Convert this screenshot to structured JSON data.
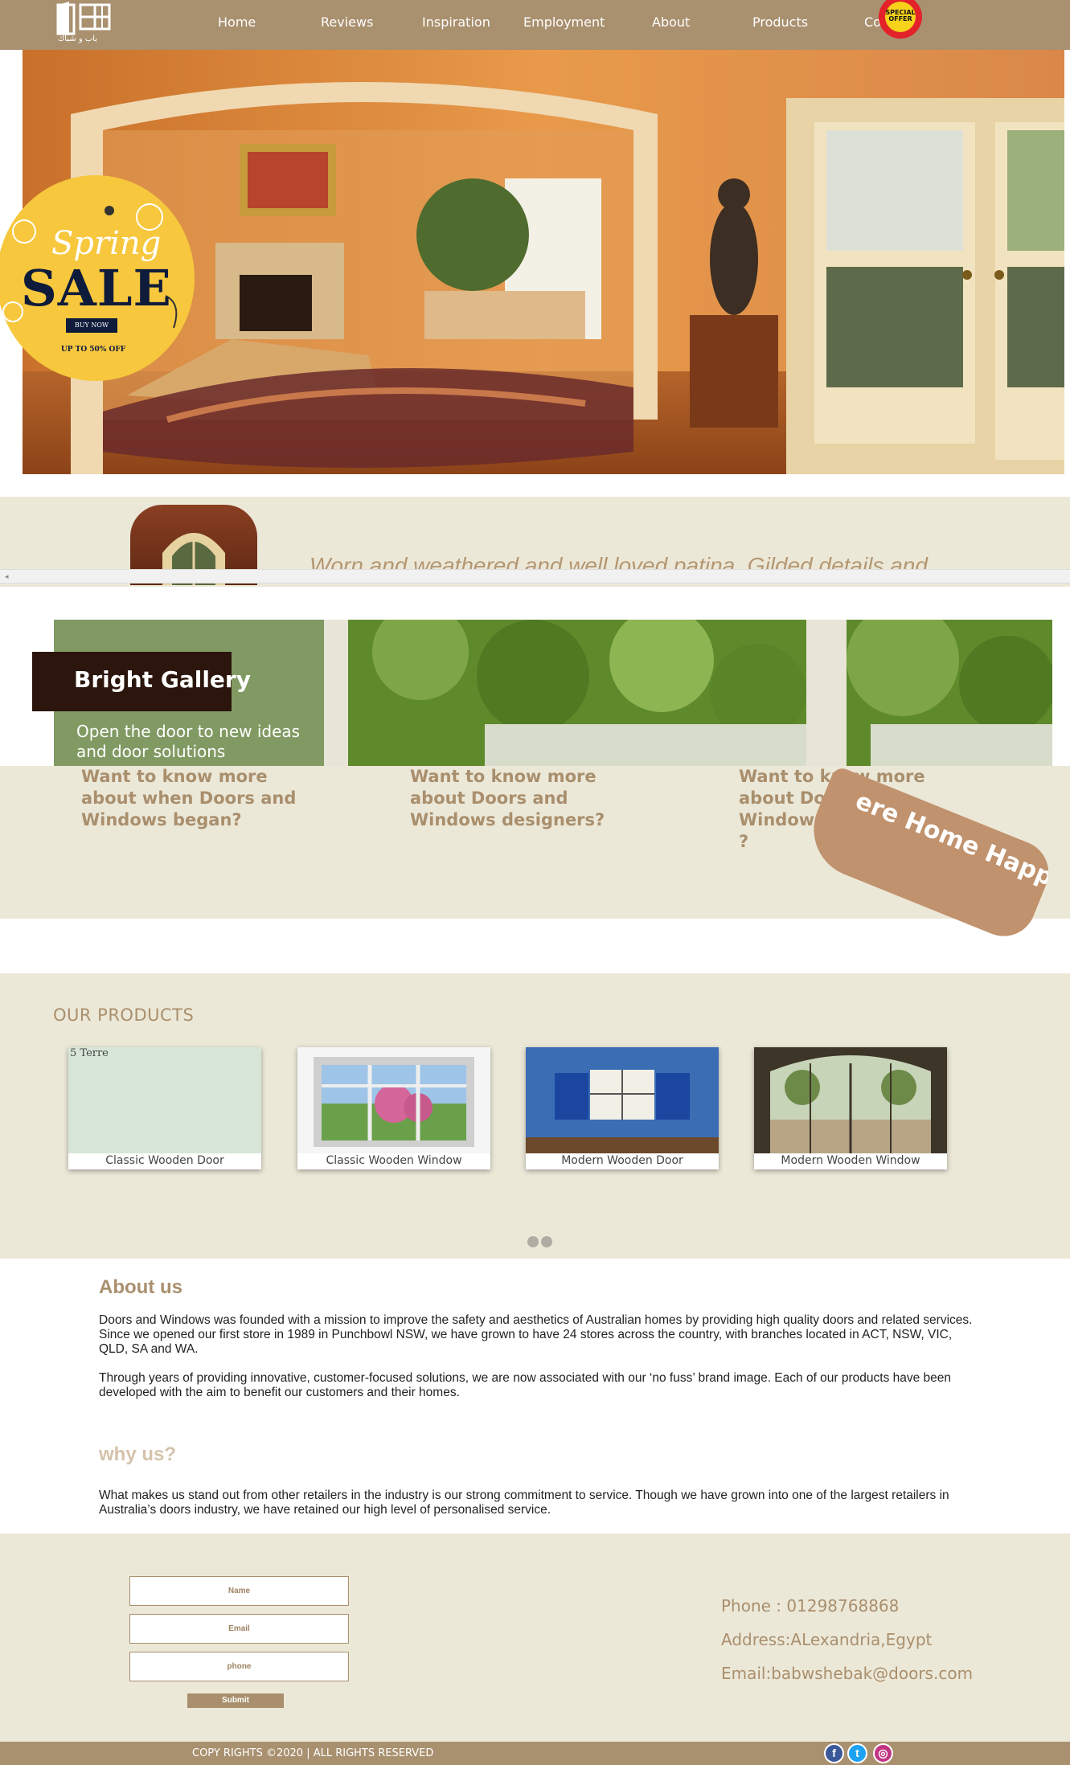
{
  "nav": {
    "logo_caption": "باب و شباك",
    "items": [
      "Home",
      "Reviews",
      "Inspiration",
      "Employment",
      "About",
      "Products",
      "Co"
    ],
    "offer_badge": "SPECIAL OFFER"
  },
  "sale_badge": {
    "spring": "Spring",
    "sale": "SALE",
    "button": "BUY NOW",
    "discount": "UP TO 50% OFF"
  },
  "strip": {
    "quote": "Worn and weathered and well loved patina. Gilded details and"
  },
  "gallery": {
    "title": "Bright Gallery",
    "subtitle": "Open the door to new ideas and door solutions",
    "questions": [
      "Want to know more about when Doors and Windows began?",
      "Want to know more about Doors and Windows designers?",
      "Want to know more about Doors and Windows contributors ?"
    ],
    "ribbon": "ere Home Happens"
  },
  "products": {
    "heading": "OUR PRODUCTS",
    "broken_image_alt": "5 Terre",
    "items": [
      {
        "caption": "Classic Wooden Door"
      },
      {
        "caption": "Classic Wooden Window"
      },
      {
        "caption": "Modern Wooden Door"
      },
      {
        "caption": "Modern Wooden Window"
      }
    ],
    "pager_dots": 2
  },
  "about": {
    "heading": "About us",
    "p1": "Doors and Windows was founded with a mission to improve the safety and aesthetics of Australian homes by providing high quality doors and related services. Since we opened our first store in 1989 in Punchbowl NSW, we have grown to have 24 stores across the country, with branches located in ACT, NSW, VIC, QLD, SA and WA.",
    "p2": "Through years of providing innovative, customer-focused solutions, we are now associated with our ‘no fuss’ brand image. Each of our products have been developed with the aim to benefit our customers and their homes.",
    "why_heading": "why us?",
    "p3": "What makes us stand out from other retailers in the industry is our strong commitment to service. Though we have grown into one of the largest retailers in Australia’s doors industry, we have retained our high level of personalised service."
  },
  "contact": {
    "name_placeholder": "Name",
    "email_placeholder": "Email",
    "phone_placeholder": "phone",
    "submit": "Submit",
    "phone": "Phone : 01298768868",
    "address": "Address:ALexandria,Egypt",
    "email": "Email:babwshebak@doors.com"
  },
  "footer": {
    "copyright": "COPY RIGHTS ©2020 | ALL RIGHTS RESERVED",
    "social": [
      "facebook-icon",
      "twitter-icon",
      "instagram-icon"
    ]
  },
  "colors": {
    "nav": "#a9906f",
    "beige": "#ece8d8",
    "accent_text": "#a98f6d",
    "gallery_green": "#819a63",
    "gallery_title_bg": "#2b150c",
    "ribbon": "#c0926d"
  }
}
